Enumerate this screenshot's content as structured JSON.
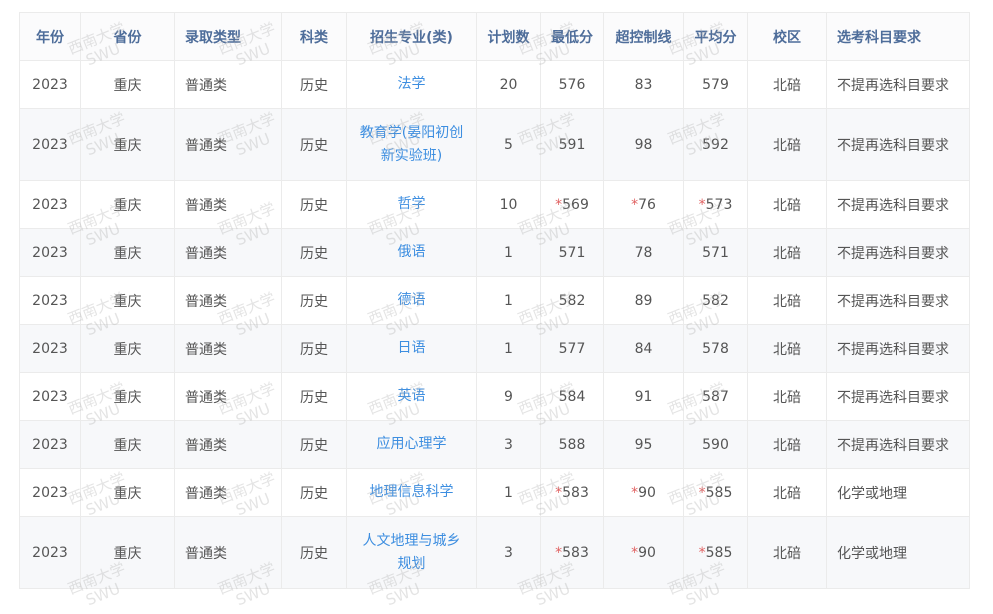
{
  "table": {
    "headers": [
      "年份",
      "省份",
      "录取类型",
      "科类",
      "招生专业(类)",
      "计划数",
      "最低分",
      "超控制线",
      "平均分",
      "校区",
      "选考科目要求"
    ],
    "rows": [
      {
        "year": "2023",
        "province": "重庆",
        "type": "普通类",
        "subject": "历史",
        "major": "法学",
        "plan": "20",
        "min_mark": "",
        "min": "576",
        "over_mark": "",
        "over": "83",
        "avg_mark": "",
        "avg": "579",
        "campus": "北碚",
        "requirement": "不提再选科目要求"
      },
      {
        "year": "2023",
        "province": "重庆",
        "type": "普通类",
        "subject": "历史",
        "major": "教育学(晏阳初创新实验班)",
        "plan": "5",
        "min_mark": "",
        "min": "591",
        "over_mark": "",
        "over": "98",
        "avg_mark": "",
        "avg": "592",
        "campus": "北碚",
        "requirement": "不提再选科目要求"
      },
      {
        "year": "2023",
        "province": "重庆",
        "type": "普通类",
        "subject": "历史",
        "major": "哲学",
        "plan": "10",
        "min_mark": "*",
        "min": "569",
        "over_mark": "*",
        "over": "76",
        "avg_mark": "*",
        "avg": "573",
        "campus": "北碚",
        "requirement": "不提再选科目要求"
      },
      {
        "year": "2023",
        "province": "重庆",
        "type": "普通类",
        "subject": "历史",
        "major": "俄语",
        "plan": "1",
        "min_mark": "",
        "min": "571",
        "over_mark": "",
        "over": "78",
        "avg_mark": "",
        "avg": "571",
        "campus": "北碚",
        "requirement": "不提再选科目要求"
      },
      {
        "year": "2023",
        "province": "重庆",
        "type": "普通类",
        "subject": "历史",
        "major": "德语",
        "plan": "1",
        "min_mark": "",
        "min": "582",
        "over_mark": "",
        "over": "89",
        "avg_mark": "",
        "avg": "582",
        "campus": "北碚",
        "requirement": "不提再选科目要求"
      },
      {
        "year": "2023",
        "province": "重庆",
        "type": "普通类",
        "subject": "历史",
        "major": "日语",
        "plan": "1",
        "min_mark": "",
        "min": "577",
        "over_mark": "",
        "over": "84",
        "avg_mark": "",
        "avg": "578",
        "campus": "北碚",
        "requirement": "不提再选科目要求"
      },
      {
        "year": "2023",
        "province": "重庆",
        "type": "普通类",
        "subject": "历史",
        "major": "英语",
        "plan": "9",
        "min_mark": "",
        "min": "584",
        "over_mark": "",
        "over": "91",
        "avg_mark": "",
        "avg": "587",
        "campus": "北碚",
        "requirement": "不提再选科目要求"
      },
      {
        "year": "2023",
        "province": "重庆",
        "type": "普通类",
        "subject": "历史",
        "major": "应用心理学",
        "plan": "3",
        "min_mark": "",
        "min": "588",
        "over_mark": "",
        "over": "95",
        "avg_mark": "",
        "avg": "590",
        "campus": "北碚",
        "requirement": "不提再选科目要求"
      },
      {
        "year": "2023",
        "province": "重庆",
        "type": "普通类",
        "subject": "历史",
        "major": "地理信息科学",
        "plan": "1",
        "min_mark": "*",
        "min": "583",
        "over_mark": "*",
        "over": "90",
        "avg_mark": "*",
        "avg": "585",
        "campus": "北碚",
        "requirement": "化学或地理"
      },
      {
        "year": "2023",
        "province": "重庆",
        "type": "普通类",
        "subject": "历史",
        "major": "人文地理与城乡规划",
        "plan": "3",
        "min_mark": "*",
        "min": "583",
        "over_mark": "*",
        "over": "90",
        "avg_mark": "*",
        "avg": "585",
        "campus": "北碚",
        "requirement": "化学或地理"
      }
    ]
  },
  "watermark": {
    "line1": "西南大学",
    "line2": "SWU"
  }
}
